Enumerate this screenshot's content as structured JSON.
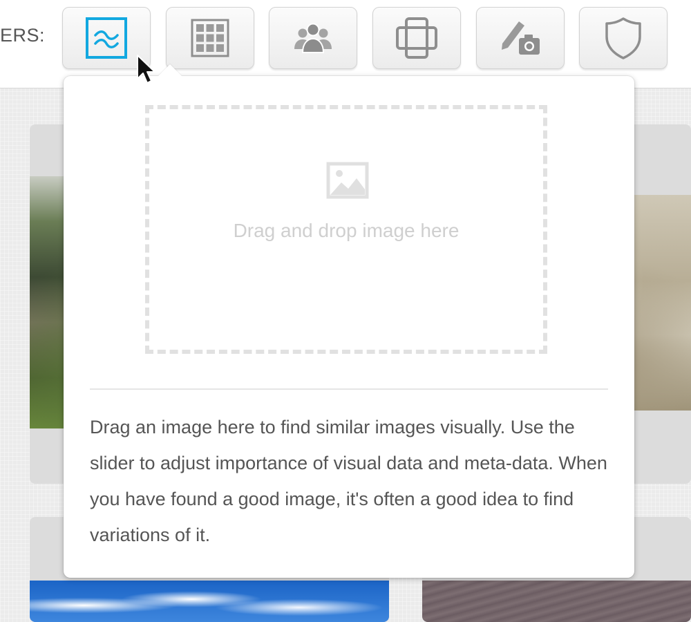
{
  "toolbar": {
    "filters_label": "ERS:",
    "buttons": [
      {
        "icon": "visual-similarity-icon",
        "active": true
      },
      {
        "icon": "grid-layout-icon",
        "active": false
      },
      {
        "icon": "people-icon",
        "active": false
      },
      {
        "icon": "frame-orientation-icon",
        "active": false
      },
      {
        "icon": "pen-camera-icon",
        "active": false
      },
      {
        "icon": "shield-icon",
        "active": false
      }
    ]
  },
  "popover": {
    "dropzone_text": "Drag and drop image here",
    "dropzone_icon": "image-placeholder-icon",
    "help_text": "Drag an image here to find similar images visually. Use the slider to adjust importance of visual data and meta-data. When you have found a good image, it's often a good idea to find variations of it."
  },
  "colors": {
    "accent": "#12a8e0",
    "icon_gray": "#8e8e8e",
    "placeholder": "#cfcfcf"
  }
}
